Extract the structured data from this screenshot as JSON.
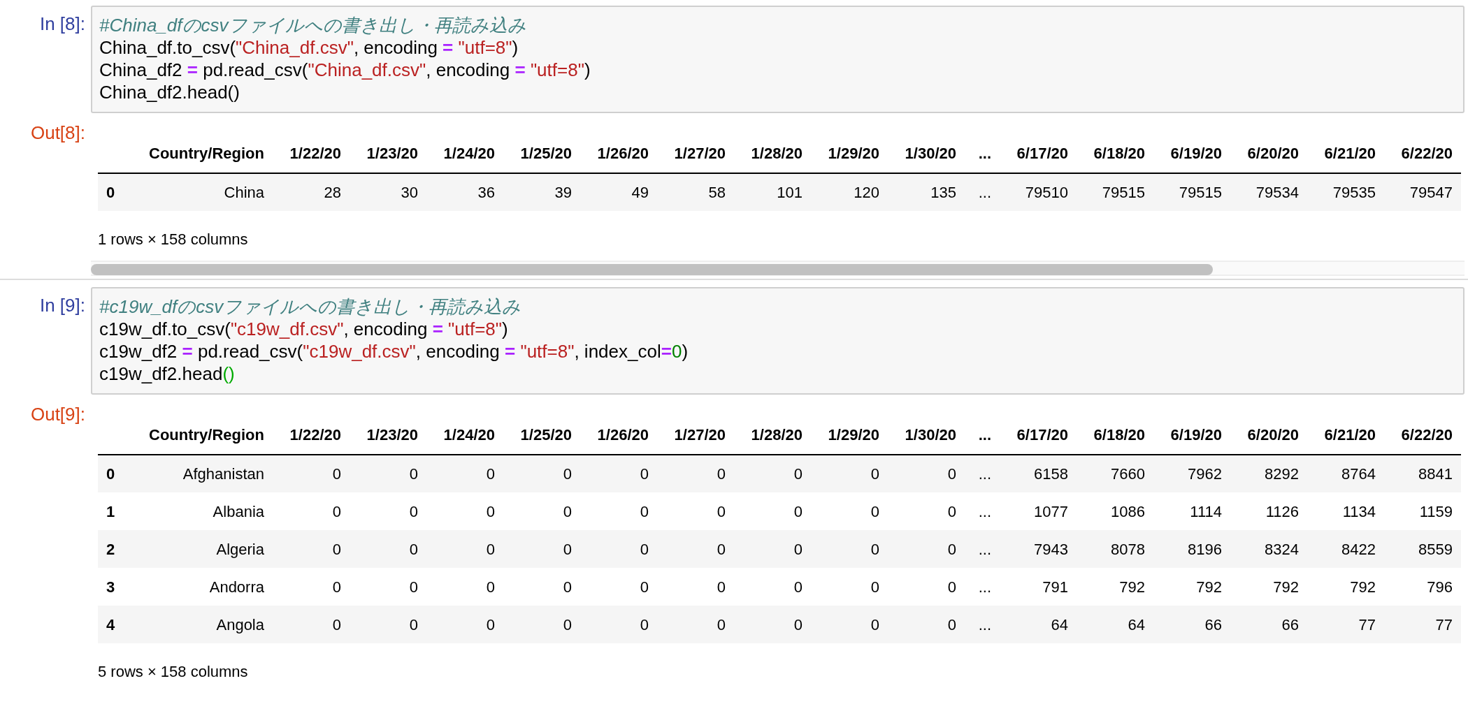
{
  "cells": [
    {
      "prompt": "In [8]:",
      "code": [
        [
          {
            "kind": "comment",
            "text": "#China_dfのcsvファイルへの書き出し・再読み込み"
          }
        ],
        [
          {
            "kind": "text",
            "text": "China_df.to_csv("
          },
          {
            "kind": "string",
            "text": "\"China_df.csv\""
          },
          {
            "kind": "text",
            "text": ", encoding "
          },
          {
            "kind": "op",
            "text": "="
          },
          {
            "kind": "string",
            "text": " \"utf=8\""
          },
          {
            "kind": "text",
            "text": ")"
          }
        ],
        [
          {
            "kind": "text",
            "text": "China_df2 "
          },
          {
            "kind": "op",
            "text": "="
          },
          {
            "kind": "text",
            "text": " pd.read_csv("
          },
          {
            "kind": "string",
            "text": "\"China_df.csv\""
          },
          {
            "kind": "text",
            "text": ", encoding "
          },
          {
            "kind": "op",
            "text": "="
          },
          {
            "kind": "string",
            "text": " \"utf=8\""
          },
          {
            "kind": "text",
            "text": ")"
          }
        ],
        [
          {
            "kind": "text",
            "text": "China_df2.head()"
          }
        ]
      ],
      "output": {
        "prompt": "Out[8]:",
        "columns": [
          "Country/Region",
          "1/22/20",
          "1/23/20",
          "1/24/20",
          "1/25/20",
          "1/26/20",
          "1/27/20",
          "1/28/20",
          "1/29/20",
          "1/30/20",
          "...",
          "6/17/20",
          "6/18/20",
          "6/19/20",
          "6/20/20",
          "6/21/20",
          "6/22/20"
        ],
        "rows": [
          {
            "index": "0",
            "values": [
              "China",
              "28",
              "30",
              "36",
              "39",
              "49",
              "58",
              "101",
              "120",
              "135",
              "...",
              "79510",
              "79515",
              "79515",
              "79534",
              "79535",
              "79547"
            ]
          }
        ],
        "summary": "1 rows × 158 columns",
        "scrollbar": true
      }
    },
    {
      "prompt": "In [9]:",
      "code": [
        [
          {
            "kind": "comment",
            "text": "#c19w_dfのcsvファイルへの書き出し・再読み込み"
          }
        ],
        [
          {
            "kind": "text",
            "text": "c19w_df.to_csv("
          },
          {
            "kind": "string",
            "text": "\"c19w_df.csv\""
          },
          {
            "kind": "text",
            "text": ", encoding "
          },
          {
            "kind": "op",
            "text": "="
          },
          {
            "kind": "string",
            "text": " \"utf=8\""
          },
          {
            "kind": "text",
            "text": ")"
          }
        ],
        [
          {
            "kind": "text",
            "text": "c19w_df2 "
          },
          {
            "kind": "op",
            "text": "="
          },
          {
            "kind": "text",
            "text": " pd.read_csv("
          },
          {
            "kind": "string",
            "text": "\"c19w_df.csv\""
          },
          {
            "kind": "text",
            "text": ", encoding "
          },
          {
            "kind": "op",
            "text": "="
          },
          {
            "kind": "string",
            "text": " \"utf=8\""
          },
          {
            "kind": "text",
            "text": ", index_col"
          },
          {
            "kind": "op",
            "text": "="
          },
          {
            "kind": "num",
            "text": "0"
          },
          {
            "kind": "text",
            "text": ")"
          }
        ],
        [
          {
            "kind": "text",
            "text": "c19w_df2.head"
          },
          {
            "kind": "paren",
            "text": "()"
          }
        ]
      ],
      "output": {
        "prompt": "Out[9]:",
        "columns": [
          "Country/Region",
          "1/22/20",
          "1/23/20",
          "1/24/20",
          "1/25/20",
          "1/26/20",
          "1/27/20",
          "1/28/20",
          "1/29/20",
          "1/30/20",
          "...",
          "6/17/20",
          "6/18/20",
          "6/19/20",
          "6/20/20",
          "6/21/20",
          "6/22/20"
        ],
        "rows": [
          {
            "index": "0",
            "values": [
              "Afghanistan",
              "0",
              "0",
              "0",
              "0",
              "0",
              "0",
              "0",
              "0",
              "0",
              "...",
              "6158",
              "7660",
              "7962",
              "8292",
              "8764",
              "8841"
            ]
          },
          {
            "index": "1",
            "values": [
              "Albania",
              "0",
              "0",
              "0",
              "0",
              "0",
              "0",
              "0",
              "0",
              "0",
              "...",
              "1077",
              "1086",
              "1114",
              "1126",
              "1134",
              "1159"
            ]
          },
          {
            "index": "2",
            "values": [
              "Algeria",
              "0",
              "0",
              "0",
              "0",
              "0",
              "0",
              "0",
              "0",
              "0",
              "...",
              "7943",
              "8078",
              "8196",
              "8324",
              "8422",
              "8559"
            ]
          },
          {
            "index": "3",
            "values": [
              "Andorra",
              "0",
              "0",
              "0",
              "0",
              "0",
              "0",
              "0",
              "0",
              "0",
              "...",
              "791",
              "792",
              "792",
              "792",
              "792",
              "796"
            ]
          },
          {
            "index": "4",
            "values": [
              "Angola",
              "0",
              "0",
              "0",
              "0",
              "0",
              "0",
              "0",
              "0",
              "0",
              "...",
              "64",
              "64",
              "66",
              "66",
              "77",
              "77"
            ]
          }
        ],
        "summary": "5 rows × 158 columns",
        "scrollbar": false
      }
    }
  ]
}
